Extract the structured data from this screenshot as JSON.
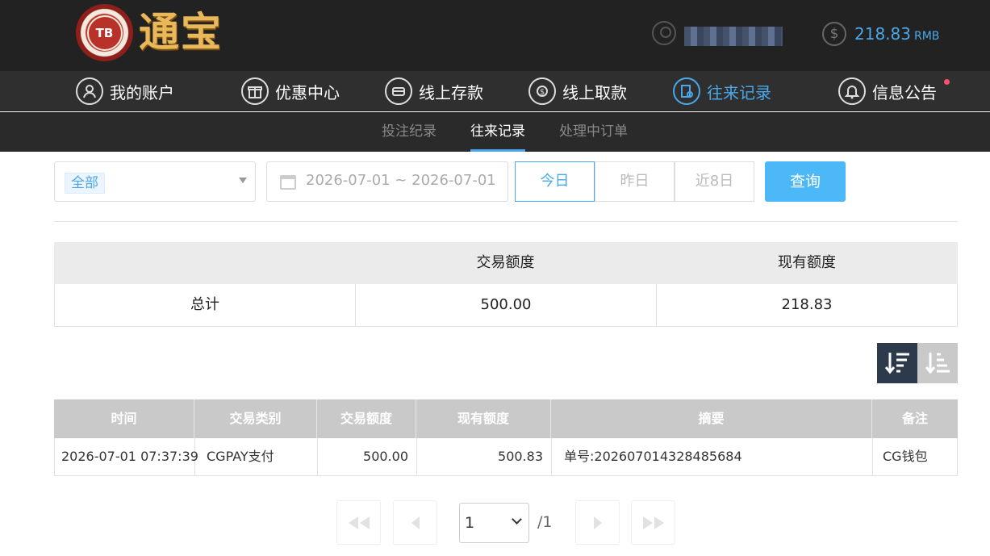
{
  "header": {
    "logo_badge": "TB",
    "logo_text": "通宝",
    "balance_value": "218.83",
    "balance_unit": "RMB"
  },
  "main_nav": [
    {
      "label": "我的账户",
      "icon": "user-icon"
    },
    {
      "label": "优惠中心",
      "icon": "gift-icon"
    },
    {
      "label": "线上存款",
      "icon": "deposit-icon"
    },
    {
      "label": "线上取款",
      "icon": "withdraw-icon"
    },
    {
      "label": "往来记录",
      "icon": "records-icon",
      "active": true
    },
    {
      "label": "信息公告",
      "icon": "bell-icon"
    }
  ],
  "sub_nav": [
    {
      "label": "投注纪录"
    },
    {
      "label": "往来记录",
      "active": true
    },
    {
      "label": "处理中订单"
    }
  ],
  "filters": {
    "type_tag": "全部",
    "date_range": "2026-07-01 ~ 2026-07-01",
    "quick": [
      "今日",
      "昨日",
      "近8日"
    ],
    "query_label": "查询"
  },
  "summary": {
    "headers": [
      "",
      "交易额度",
      "现有额度"
    ],
    "row": [
      "总计",
      "500.00",
      "218.83"
    ]
  },
  "records": {
    "headers": [
      "时间",
      "交易类别",
      "交易额度",
      "现有额度",
      "摘要",
      "备注"
    ],
    "rows": [
      [
        "2026-07-01 07:37:39",
        "CGPAY支付",
        "500.00",
        "500.83",
        "单号:202607014328485684",
        "CG钱包"
      ]
    ]
  },
  "pagination": {
    "current_page": "1",
    "total": "/1"
  },
  "colors": {
    "accent": "#4aa8ea",
    "header_bg": "#222222",
    "nav_bg": "#2f2f2f",
    "query_button": "#4db8f7",
    "notification_dot": "#ff4d6d"
  }
}
